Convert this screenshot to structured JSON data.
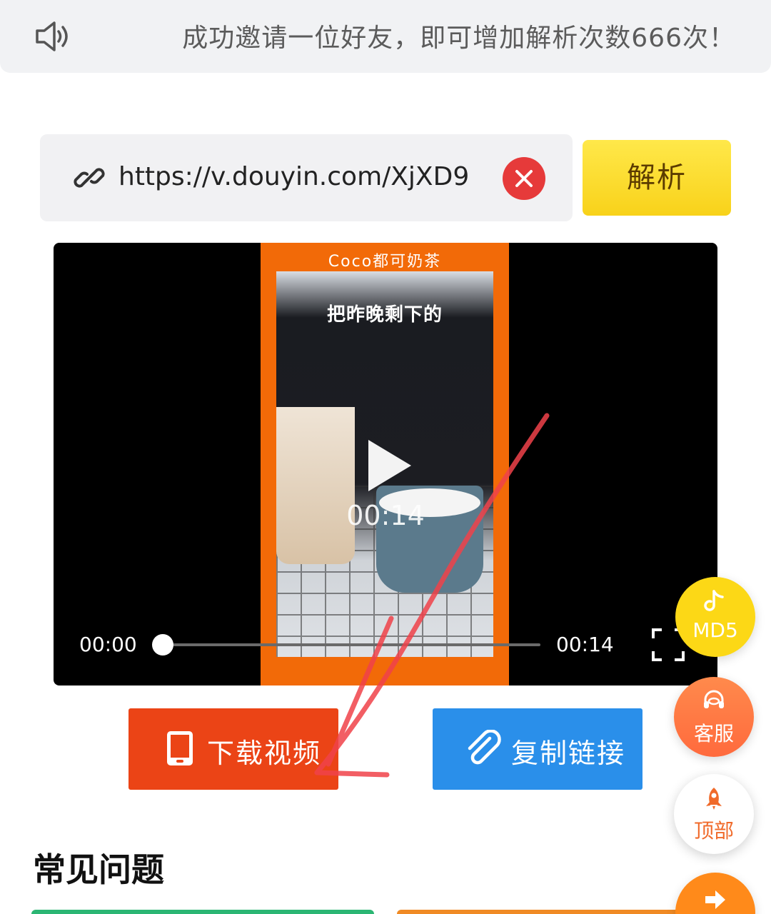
{
  "notice": {
    "icon": "speaker-icon",
    "message": "成功邀请一位好友，即可增加解析次数666次！"
  },
  "search": {
    "icon": "link-icon",
    "url_value": "https://v.douyin.com/XjXD9",
    "clear_icon": "close-icon",
    "parse_label": "解析",
    "parse_color": "#f8d21a"
  },
  "player": {
    "brand_text": "Coco都可奶茶",
    "caption_text": "把昨晚剩下的",
    "center_time": "00:14",
    "current_time": "00:00",
    "duration": "00:14",
    "progress_fraction": 0.0
  },
  "actions": {
    "download_label": "下载视频",
    "download_icon": "phone-icon",
    "download_color": "#eb4416",
    "copy_label": "复制链接",
    "copy_icon": "paperclip-icon",
    "copy_color": "#2a8fea"
  },
  "faq": {
    "title": "常见问题"
  },
  "floating": [
    {
      "label": "MD5",
      "icon": "music-note-icon"
    },
    {
      "label": "客服",
      "icon": "headset-icon"
    },
    {
      "label": "顶部",
      "icon": "rocket-icon"
    },
    {
      "label": "",
      "icon": "arrow-right-icon"
    }
  ]
}
